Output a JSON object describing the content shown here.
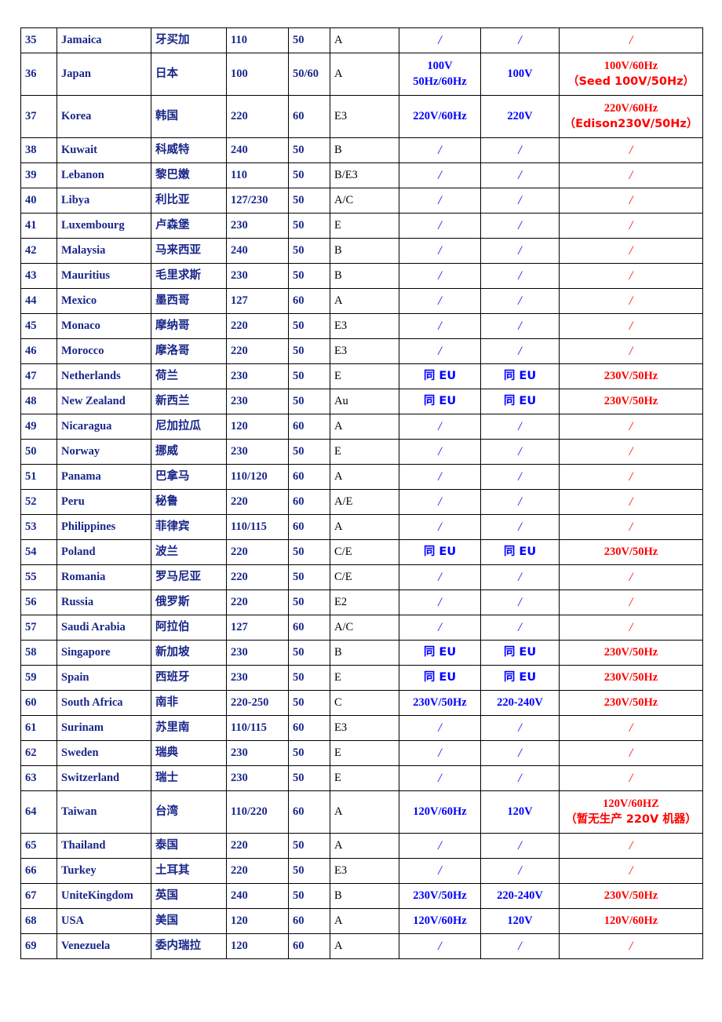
{
  "document": {
    "type": "table",
    "title": "World Voltage / Frequency / Plug-Type Reference Table",
    "colors": {
      "heading_navy": "#192688",
      "value_blue": "#0000FF",
      "note_red": "#FF0000",
      "plug_black": "#000000",
      "border": "#000000",
      "background": "#FFFFFF"
    }
  },
  "columns": [
    {
      "key": "no",
      "name": "row-number"
    },
    {
      "key": "en",
      "name": "country-english"
    },
    {
      "key": "cn",
      "name": "country-chinese"
    },
    {
      "key": "volt",
      "name": "voltage"
    },
    {
      "key": "freq",
      "name": "frequency"
    },
    {
      "key": "plug",
      "name": "plug-type"
    },
    {
      "key": "std",
      "name": "standard-spec"
    },
    {
      "key": "rated",
      "name": "rated-voltage"
    },
    {
      "key": "note",
      "name": "production-note"
    }
  ],
  "rows": [
    {
      "no": "35",
      "en": "Jamaica",
      "cn": "牙买加",
      "volt": "110",
      "freq": "50",
      "plug": "A",
      "std": [
        "/"
      ],
      "rated": [
        "/"
      ],
      "note": [
        "/"
      ],
      "tall": false
    },
    {
      "no": "36",
      "en": "Japan",
      "cn": "日本",
      "volt": "100",
      "freq": "50/60",
      "plug": "A",
      "std": [
        "100V",
        "50Hz/60Hz"
      ],
      "rated": [
        "100V"
      ],
      "note": [
        "100V/60Hz",
        "（Seed 100V/50Hz）"
      ],
      "tall": true
    },
    {
      "no": "37",
      "en": "Korea",
      "cn": "韩国",
      "volt": "220",
      "freq": "60",
      "plug": "E3",
      "std": [
        "220V/60Hz"
      ],
      "rated": [
        "220V"
      ],
      "note": [
        "220V/60Hz",
        "（Edison230V/50Hz）"
      ],
      "tall": true
    },
    {
      "no": "38",
      "en": "Kuwait",
      "cn": "科威特",
      "volt": "240",
      "freq": "50",
      "plug": "B",
      "std": [
        "/"
      ],
      "rated": [
        "/"
      ],
      "note": [
        "/"
      ],
      "tall": false
    },
    {
      "no": "39",
      "en": "Lebanon",
      "cn": "黎巴嫩",
      "volt": "110",
      "freq": "50",
      "plug": "B/E3",
      "std": [
        "/"
      ],
      "rated": [
        "/"
      ],
      "note": [
        "/"
      ],
      "tall": false
    },
    {
      "no": "40",
      "en": "Libya",
      "cn": "利比亚",
      "volt": "127/230",
      "freq": "50",
      "plug": "A/C",
      "std": [
        "/"
      ],
      "rated": [
        "/"
      ],
      "note": [
        "/"
      ],
      "tall": false
    },
    {
      "no": "41",
      "en": "Luxembourg",
      "cn": "卢森堡",
      "volt": "230",
      "freq": "50",
      "plug": "E",
      "std": [
        "/"
      ],
      "rated": [
        "/"
      ],
      "note": [
        "/"
      ],
      "tall": false
    },
    {
      "no": "42",
      "en": "Malaysia",
      "cn": "马来西亚",
      "volt": "240",
      "freq": "50",
      "plug": "B",
      "std": [
        "/"
      ],
      "rated": [
        "/"
      ],
      "note": [
        "/"
      ],
      "tall": false
    },
    {
      "no": "43",
      "en": "Mauritius",
      "cn": "毛里求斯",
      "volt": "230",
      "freq": "50",
      "plug": "B",
      "std": [
        "/"
      ],
      "rated": [
        "/"
      ],
      "note": [
        "/"
      ],
      "tall": false
    },
    {
      "no": "44",
      "en": "Mexico",
      "cn": "墨西哥",
      "volt": "127",
      "freq": "60",
      "plug": "A",
      "std": [
        "/"
      ],
      "rated": [
        "/"
      ],
      "note": [
        "/"
      ],
      "tall": false
    },
    {
      "no": "45",
      "en": "Monaco",
      "cn": "摩纳哥",
      "volt": "220",
      "freq": "50",
      "plug": "E3",
      "std": [
        "/"
      ],
      "rated": [
        "/"
      ],
      "note": [
        "/"
      ],
      "tall": false
    },
    {
      "no": "46",
      "en": "Morocco",
      "cn": "摩洛哥",
      "volt": "220",
      "freq": "50",
      "plug": "E3",
      "std": [
        "/"
      ],
      "rated": [
        "/"
      ],
      "note": [
        "/"
      ],
      "tall": false
    },
    {
      "no": "47",
      "en": "Netherlands",
      "cn": "荷兰",
      "volt": "230",
      "freq": "50",
      "plug": "E",
      "std": [
        "同 EU"
      ],
      "rated": [
        "同 EU"
      ],
      "note": [
        "230V/50Hz"
      ],
      "tall": false
    },
    {
      "no": "48",
      "en": "New Zealand",
      "cn": "新西兰",
      "volt": "230",
      "freq": "50",
      "plug": "Au",
      "std": [
        "同 EU"
      ],
      "rated": [
        "同 EU"
      ],
      "note": [
        "230V/50Hz"
      ],
      "tall": false
    },
    {
      "no": "49",
      "en": "Nicaragua",
      "cn": "尼加拉瓜",
      "volt": "120",
      "freq": "60",
      "plug": "A",
      "std": [
        "/"
      ],
      "rated": [
        "/"
      ],
      "note": [
        "/"
      ],
      "tall": false
    },
    {
      "no": "50",
      "en": "Norway",
      "cn": "挪威",
      "volt": "230",
      "freq": "50",
      "plug": "E",
      "std": [
        "/"
      ],
      "rated": [
        "/"
      ],
      "note": [
        "/"
      ],
      "tall": false
    },
    {
      "no": "51",
      "en": "Panama",
      "cn": "巴拿马",
      "volt": "110/120",
      "freq": "60",
      "plug": "A",
      "std": [
        "/"
      ],
      "rated": [
        "/"
      ],
      "note": [
        "/"
      ],
      "tall": false
    },
    {
      "no": "52",
      "en": "Peru",
      "cn": "秘鲁",
      "volt": "220",
      "freq": "60",
      "plug": "A/E",
      "std": [
        "/"
      ],
      "rated": [
        "/"
      ],
      "note": [
        "/"
      ],
      "tall": false
    },
    {
      "no": "53",
      "en": "Philippines",
      "cn": "菲律宾",
      "volt": "110/115",
      "freq": "60",
      "plug": "A",
      "std": [
        "/"
      ],
      "rated": [
        "/"
      ],
      "note": [
        "/"
      ],
      "tall": false
    },
    {
      "no": "54",
      "en": "Poland",
      "cn": "波兰",
      "volt": "220",
      "freq": "50",
      "plug": "C/E",
      "std": [
        "同 EU"
      ],
      "rated": [
        "同 EU"
      ],
      "note": [
        "230V/50Hz"
      ],
      "tall": false
    },
    {
      "no": "55",
      "en": "Romania",
      "cn": "罗马尼亚",
      "volt": "220",
      "freq": "50",
      "plug": "C/E",
      "std": [
        "/"
      ],
      "rated": [
        "/"
      ],
      "note": [
        "/"
      ],
      "tall": false
    },
    {
      "no": "56",
      "en": "Russia",
      "cn": "俄罗斯",
      "volt": "220",
      "freq": "50",
      "plug": "E2",
      "std": [
        "/"
      ],
      "rated": [
        "/"
      ],
      "note": [
        "/"
      ],
      "tall": false
    },
    {
      "no": "57",
      "en": "Saudi Arabia",
      "cn": "阿拉伯",
      "volt": "127",
      "freq": "60",
      "plug": "A/C",
      "std": [
        "/"
      ],
      "rated": [
        "/"
      ],
      "note": [
        "/"
      ],
      "tall": false
    },
    {
      "no": "58",
      "en": "Singapore",
      "cn": "新加坡",
      "volt": "230",
      "freq": "50",
      "plug": "B",
      "std": [
        "同 EU"
      ],
      "rated": [
        "同 EU"
      ],
      "note": [
        "230V/50Hz"
      ],
      "tall": false
    },
    {
      "no": "59",
      "en": "Spain",
      "cn": "西班牙",
      "volt": "230",
      "freq": "50",
      "plug": "E",
      "std": [
        "同 EU"
      ],
      "rated": [
        "同 EU"
      ],
      "note": [
        "230V/50Hz"
      ],
      "tall": false
    },
    {
      "no": "60",
      "en": "South Africa",
      "cn": "南非",
      "volt": "220-250",
      "freq": "50",
      "plug": "C",
      "std": [
        "230V/50Hz"
      ],
      "rated": [
        "220-240V"
      ],
      "note": [
        "230V/50Hz"
      ],
      "tall": false
    },
    {
      "no": "61",
      "en": "Surinam",
      "cn": "苏里南",
      "volt": "110/115",
      "freq": "60",
      "plug": "E3",
      "std": [
        "/"
      ],
      "rated": [
        "/"
      ],
      "note": [
        "/"
      ],
      "tall": false
    },
    {
      "no": "62",
      "en": "Sweden",
      "cn": "瑞典",
      "volt": "230",
      "freq": "50",
      "plug": "E",
      "std": [
        "/"
      ],
      "rated": [
        "/"
      ],
      "note": [
        "/"
      ],
      "tall": false
    },
    {
      "no": "63",
      "en": "Switzerland",
      "cn": "瑞士",
      "volt": "230",
      "freq": "50",
      "plug": "E",
      "std": [
        "/"
      ],
      "rated": [
        "/"
      ],
      "note": [
        "/"
      ],
      "tall": false
    },
    {
      "no": "64",
      "en": "Taiwan",
      "cn": "台湾",
      "volt": "110/220",
      "freq": "60",
      "plug": "A",
      "std": [
        "120V/60Hz"
      ],
      "rated": [
        "120V"
      ],
      "note": [
        "120V/60HZ",
        "（暂无生产 220V 机器）"
      ],
      "tall": true
    },
    {
      "no": "65",
      "en": "Thailand",
      "cn": "泰国",
      "volt": "220",
      "freq": "50",
      "plug": "A",
      "std": [
        "/"
      ],
      "rated": [
        "/"
      ],
      "note": [
        "/"
      ],
      "tall": false
    },
    {
      "no": "66",
      "en": "Turkey",
      "cn": "土耳其",
      "volt": "220",
      "freq": "50",
      "plug": "E3",
      "std": [
        "/"
      ],
      "rated": [
        "/"
      ],
      "note": [
        "/"
      ],
      "tall": false
    },
    {
      "no": "67",
      "en": "UniteKingdom",
      "cn": "英国",
      "volt": "240",
      "freq": "50",
      "plug": "B",
      "std": [
        "230V/50Hz"
      ],
      "rated": [
        "220-240V"
      ],
      "note": [
        "230V/50Hz"
      ],
      "tall": false
    },
    {
      "no": "68",
      "en": "USA",
      "cn": "美国",
      "volt": "120",
      "freq": "60",
      "plug": "A",
      "std": [
        "120V/60Hz"
      ],
      "rated": [
        "120V"
      ],
      "note": [
        "120V/60Hz"
      ],
      "tall": false
    },
    {
      "no": "69",
      "en": "Venezuela",
      "cn": "委内瑞拉",
      "volt": "120",
      "freq": "60",
      "plug": "A",
      "std": [
        "/"
      ],
      "rated": [
        "/"
      ],
      "note": [
        "/"
      ],
      "tall": false
    }
  ]
}
